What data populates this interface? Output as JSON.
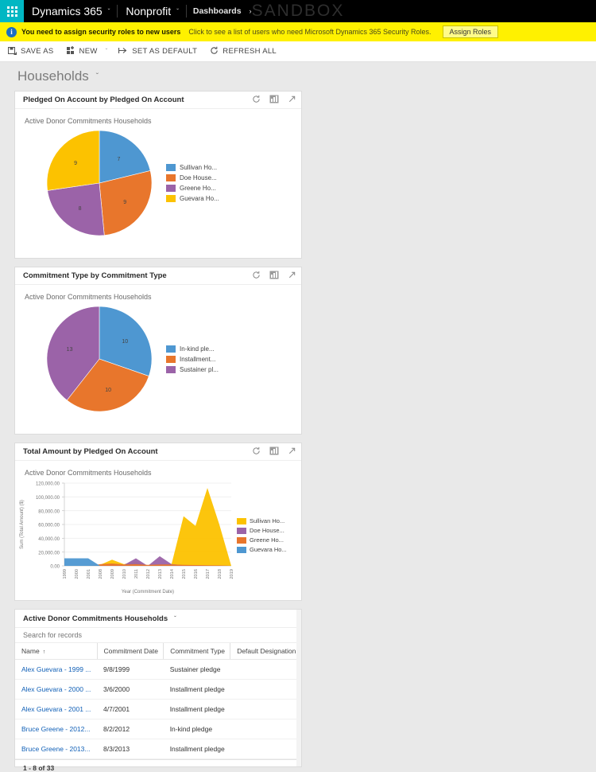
{
  "topnav": {
    "waffle_icon": "waffle-icon",
    "product": "Dynamics 365",
    "app": "Nonprofit",
    "breadcrumb": "Dashboards",
    "breadcrumb_arrow": "›",
    "watermark": "SANDBOX",
    "chevron": "ˇ"
  },
  "notice": {
    "icon": "info-icon",
    "icon_glyph": "i",
    "headline": "You need to assign security roles to new users",
    "detail": "Click to see a list of users who need Microsoft Dynamics 365 Security Roles.",
    "button": "Assign Roles"
  },
  "commandbar": {
    "save_as": "SAVE AS",
    "new": "NEW",
    "split_chevron": "ˇ",
    "set_as_default": "SET AS DEFAULT",
    "refresh_all": "REFRESH ALL"
  },
  "page": {
    "title": "Households",
    "chevron": "ˇ"
  },
  "panel_icons": {
    "refresh": "refresh-icon",
    "chart_type": "chart-type-icon",
    "expand": "expand-icon"
  },
  "panels": {
    "pie1": {
      "title": "Pledged On Account by Pledged On Account",
      "subtitle": "Active Donor Commitments Households"
    },
    "pie2": {
      "title": "Commitment Type by Commitment Type",
      "subtitle": "Active Donor Commitments Households"
    },
    "area": {
      "title": "Total Amount by Pledged On Account",
      "subtitle": "Active Donor Commitments Households"
    }
  },
  "grid": {
    "title": "Active Donor Commitments Households",
    "chevron": "ˇ",
    "search_placeholder": "Search for records",
    "columns": [
      "Name",
      "Commitment Date",
      "Commitment Type",
      "Default Designation"
    ],
    "sort_column": "Name",
    "sort_arrow": "↑",
    "rows": [
      {
        "name": "Alex Guevara - 1999 ...",
        "date": "9/8/1999",
        "type": "Sustainer pledge",
        "designation": ""
      },
      {
        "name": "Alex Guevara - 2000 ...",
        "date": "3/6/2000",
        "type": "Installment pledge",
        "designation": ""
      },
      {
        "name": "Alex Guevara - 2001 ...",
        "date": "4/7/2001",
        "type": "Installment pledge",
        "designation": ""
      },
      {
        "name": "Bruce Greene - 2012...",
        "date": "8/2/2012",
        "type": "In-kind pledge",
        "designation": ""
      },
      {
        "name": "Bruce Greene - 2013...",
        "date": "8/3/2013",
        "type": "Installment pledge",
        "designation": ""
      }
    ],
    "pager": "1 - 8 of 33"
  },
  "colors": {
    "blue": "#4e97d1",
    "orange": "#e8762c",
    "purple": "#9b63a8",
    "yellow": "#fcc200",
    "accent_teal": "#00b7c3",
    "notice_yellow": "#fff100",
    "link": "#1160b7"
  },
  "chart_data": [
    {
      "type": "pie",
      "title": "Pledged On Account by Pledged On Account",
      "subtitle": "Active Donor Commitments Households",
      "legend_position": "right",
      "labels": [
        "Sullivan Ho...",
        "Doe House...",
        "Greene Ho...",
        "Guevara Ho..."
      ],
      "values": [
        7,
        9,
        8,
        9
      ],
      "colors": [
        "#4e97d1",
        "#e8762c",
        "#9b63a8",
        "#fcc200"
      ],
      "total": 33
    },
    {
      "type": "pie",
      "title": "Commitment Type by Commitment Type",
      "subtitle": "Active Donor Commitments Households",
      "legend_position": "right",
      "labels": [
        "In-kind ple...",
        "Installment...",
        "Sustainer pl..."
      ],
      "values": [
        10,
        10,
        13
      ],
      "colors": [
        "#4e97d1",
        "#e8762c",
        "#9b63a8"
      ],
      "total": 33
    },
    {
      "type": "area",
      "title": "Total Amount by Pledged On Account",
      "subtitle": "Active Donor Commitments Households",
      "xlabel": "Year (Commitment Date)",
      "ylabel": "Sum (Total Amount) ($)",
      "ylim": [
        0,
        120000
      ],
      "yticks": [
        0,
        20000,
        40000,
        60000,
        80000,
        100000,
        120000
      ],
      "ytick_labels": [
        "0.00",
        "20,000.00",
        "40,000.00",
        "60,000.00",
        "80,000.00",
        "100,000.00",
        "120,000.00"
      ],
      "categories": [
        "1999",
        "2000",
        "2001",
        "2008",
        "2009",
        "2010",
        "2011",
        "2012",
        "2013",
        "2014",
        "2015",
        "2016",
        "2017",
        "2018",
        "2019"
      ],
      "grid": true,
      "legend_position": "right",
      "series": [
        {
          "name": "Sullivan Ho...",
          "color": "#fcc200",
          "values": [
            0,
            0,
            0,
            1500,
            9000,
            2500,
            6500,
            0,
            1500,
            3000,
            72000,
            58000,
            113000,
            60000,
            0
          ]
        },
        {
          "name": "Doe House...",
          "color": "#9b63a8",
          "values": [
            0,
            0,
            0,
            1000,
            2000,
            1500,
            11000,
            0,
            14000,
            2500,
            1000,
            800,
            600,
            500,
            0
          ]
        },
        {
          "name": "Greene Ho...",
          "color": "#e8762c",
          "values": [
            0,
            0,
            0,
            2500,
            3500,
            2000,
            2500,
            1500,
            2000,
            2000,
            1500,
            1200,
            900,
            700,
            0
          ]
        },
        {
          "name": "Guevara Ho...",
          "color": "#4e97d1",
          "values": [
            11000,
            11000,
            11000,
            0,
            0,
            0,
            0,
            0,
            0,
            0,
            0,
            0,
            0,
            0,
            0
          ]
        }
      ]
    }
  ]
}
